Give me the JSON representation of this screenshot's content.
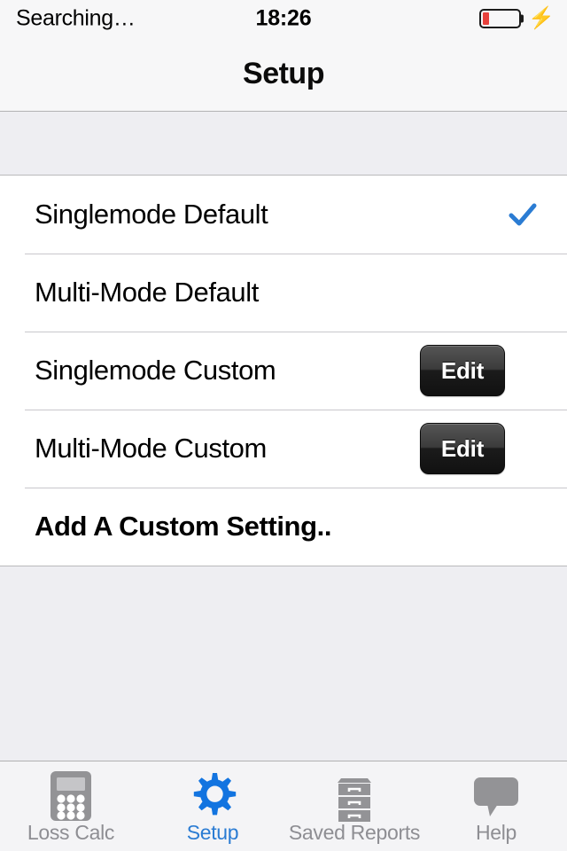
{
  "status_bar": {
    "carrier": "Searching…",
    "time": "18:26",
    "battery_icon": "battery-low-icon",
    "battery_percent": 18,
    "battery_color": "#e8413c",
    "charging_icon": "lightning-bolt-icon"
  },
  "nav_bar": {
    "title": "Setup"
  },
  "table": {
    "rows": [
      {
        "label": "Singlemode Default",
        "accessory": "checkmark",
        "bold": false
      },
      {
        "label": "Multi-Mode Default",
        "accessory": "none",
        "bold": false
      },
      {
        "label": "Singlemode Custom",
        "accessory": "edit-button",
        "edit_label": "Edit",
        "bold": false
      },
      {
        "label": "Multi-Mode Custom",
        "accessory": "edit-button",
        "edit_label": "Edit",
        "bold": false
      },
      {
        "label": "Add A Custom Setting..",
        "accessory": "none",
        "bold": true
      }
    ]
  },
  "tab_bar": {
    "selected_index": 1,
    "accent_color": "#2b7cd3",
    "inactive_color": "#8e8e93",
    "tabs": [
      {
        "label": "Loss Calc",
        "icon": "calculator-icon"
      },
      {
        "label": "Setup",
        "icon": "gear-icon"
      },
      {
        "label": "Saved Reports",
        "icon": "file-cabinet-icon"
      },
      {
        "label": "Help",
        "icon": "speech-bubble-icon"
      }
    ]
  }
}
